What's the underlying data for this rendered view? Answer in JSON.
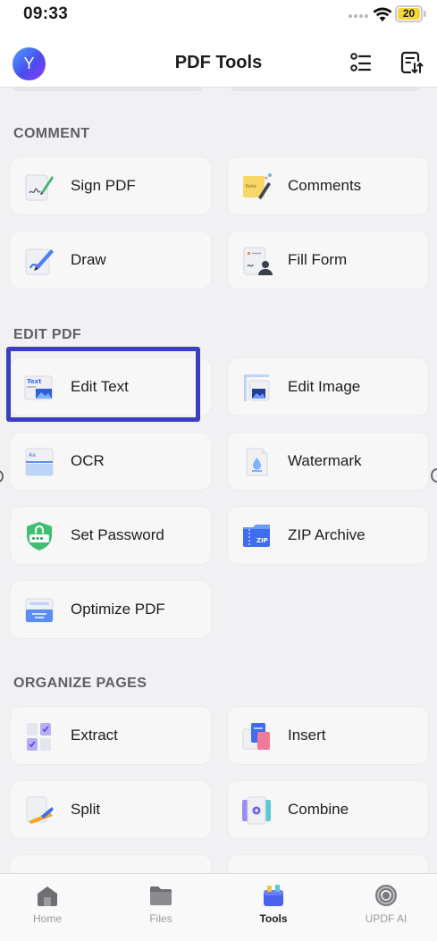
{
  "status_bar": {
    "time": "09:33",
    "battery": "20"
  },
  "header": {
    "avatar_letter": "Y",
    "title": "PDF Tools"
  },
  "sections": {
    "comment": {
      "title": "COMMENT",
      "tools": [
        {
          "label": "Sign PDF",
          "icon": "sign-pdf-icon"
        },
        {
          "label": "Comments",
          "icon": "comments-icon"
        },
        {
          "label": "Draw",
          "icon": "draw-icon"
        },
        {
          "label": "Fill Form",
          "icon": "fill-form-icon"
        }
      ]
    },
    "edit_pdf": {
      "title": "EDIT PDF",
      "tools": [
        {
          "label": "Edit Text",
          "icon": "edit-text-icon",
          "highlighted": true
        },
        {
          "label": "Edit Image",
          "icon": "edit-image-icon"
        },
        {
          "label": "OCR",
          "icon": "ocr-icon"
        },
        {
          "label": "Watermark",
          "icon": "watermark-icon"
        },
        {
          "label": "Set Password",
          "icon": "set-password-icon"
        },
        {
          "label": "ZIP Archive",
          "icon": "zip-archive-icon"
        },
        {
          "label": "Optimize PDF",
          "icon": "optimize-pdf-icon"
        }
      ]
    },
    "organize_pages": {
      "title": "ORGANIZE PAGES",
      "tools": [
        {
          "label": "Extract",
          "icon": "extract-icon"
        },
        {
          "label": "Insert",
          "icon": "insert-icon"
        },
        {
          "label": "Split",
          "icon": "split-icon"
        },
        {
          "label": "Combine",
          "icon": "combine-icon"
        }
      ]
    }
  },
  "tabbar": {
    "tabs": [
      {
        "label": "Home",
        "icon": "home-icon"
      },
      {
        "label": "Files",
        "icon": "folder-icon"
      },
      {
        "label": "Tools",
        "icon": "toolbox-icon",
        "active": true
      },
      {
        "label": "UPDF AI",
        "icon": "ai-icon"
      }
    ]
  },
  "colors": {
    "highlight_border": "#3b3fbf",
    "accent": "#4a62f0",
    "background": "#f1f1f3"
  }
}
